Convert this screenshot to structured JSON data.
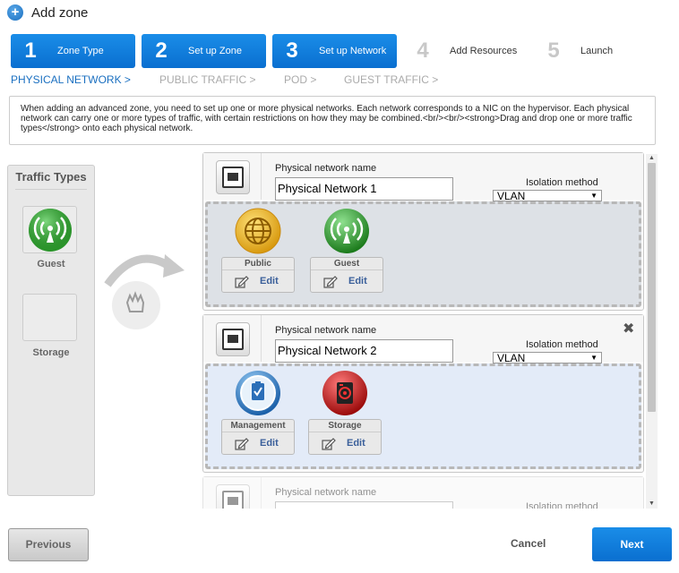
{
  "window": {
    "title": "Add zone"
  },
  "steps": [
    {
      "num": "1",
      "label": "Zone Type",
      "state": "active"
    },
    {
      "num": "2",
      "label": "Set up Zone",
      "state": "active"
    },
    {
      "num": "3",
      "label": "Set up Network",
      "state": "active"
    },
    {
      "num": "4",
      "label": "Add Resources",
      "state": "inactive"
    },
    {
      "num": "5",
      "label": "Launch",
      "state": "inactive"
    }
  ],
  "subtabs": [
    {
      "label": "PHYSICAL NETWORK >",
      "state": "active"
    },
    {
      "label": "PUBLIC TRAFFIC >",
      "state": "inactive"
    },
    {
      "label": "POD >",
      "state": "inactive"
    },
    {
      "label": "GUEST TRAFFIC >",
      "state": "inactive"
    }
  ],
  "description": "When adding an advanced zone, you need to set up one or more physical networks. Each network corresponds to a NIC on the hypervisor. Each physical network can carry one or more types of traffic, with certain restrictions on how they may be combined.<br/><br/><strong>Drag and drop one or more traffic types</strong> onto each physical network.",
  "traffic_types": {
    "title": "Traffic Types",
    "items": [
      {
        "label": "Guest",
        "icon": "guest-traffic-icon"
      },
      {
        "label": "Storage",
        "icon": "empty-slot"
      }
    ]
  },
  "networks": [
    {
      "name_label": "Physical network name",
      "name_value": "Physical Network 1",
      "isolation_label": "Isolation method",
      "isolation_value": "VLAN",
      "removable": false,
      "traffic": [
        {
          "name": "Public",
          "edit": "Edit",
          "icon": "public-traffic-icon"
        },
        {
          "name": "Guest",
          "edit": "Edit",
          "icon": "guest-traffic-icon"
        }
      ]
    },
    {
      "name_label": "Physical network name",
      "name_value": "Physical Network 2",
      "isolation_label": "Isolation method",
      "isolation_value": "VLAN",
      "removable": true,
      "remove_glyph": "✖",
      "traffic": [
        {
          "name": "Management",
          "edit": "Edit",
          "icon": "management-traffic-icon"
        },
        {
          "name": "Storage",
          "edit": "Edit",
          "icon": "storage-traffic-icon"
        }
      ]
    },
    {
      "name_label": "Physical network name",
      "name_value": "",
      "isolation_label": "Isolation method",
      "isolation_value": "",
      "removable": false,
      "traffic": []
    }
  ],
  "buttons": {
    "previous": "Previous",
    "cancel": "Cancel",
    "next": "Next"
  },
  "colors": {
    "accent": "#0a6fd0",
    "active_tab_text": "#1a6fc0",
    "drop_zone_grey": "#dde1e6",
    "drop_zone_blue": "#e3ebf8"
  }
}
